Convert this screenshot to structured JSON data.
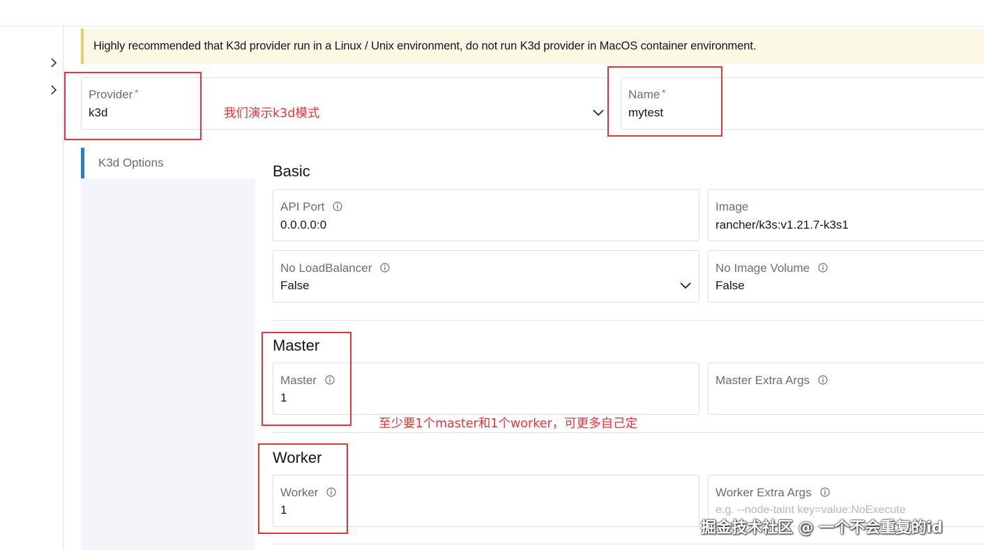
{
  "banner": {
    "text": "Highly recommended that K3d provider run in a Linux / Unix environment, do not run K3d provider in MacOS container environment."
  },
  "provider": {
    "label": "Provider",
    "required_mark": "*",
    "value": "k3d"
  },
  "name": {
    "label": "Name",
    "required_mark": "*",
    "value": "mytest"
  },
  "tabs": [
    {
      "label": "K3d Options"
    }
  ],
  "basic": {
    "title": "Basic",
    "api_port": {
      "label": "API Port",
      "value": "0.0.0.0:0"
    },
    "image": {
      "label": "Image",
      "value": "rancher/k3s:v1.21.7-k3s1"
    },
    "no_loadbalancer": {
      "label": "No LoadBalancer",
      "value": "False"
    },
    "no_image_volume": {
      "label": "No Image Volume",
      "value": "False"
    }
  },
  "master": {
    "title": "Master",
    "count": {
      "label": "Master",
      "value": "1"
    },
    "extra_args": {
      "label": "Master Extra Args",
      "value": ""
    }
  },
  "worker": {
    "title": "Worker",
    "count": {
      "label": "Worker",
      "value": "1"
    },
    "extra_args": {
      "label": "Worker Extra Args",
      "placeholder": "e.g. --node-taint key=value:NoExecute"
    }
  },
  "annotations": {
    "provider_note": "我们演示k3d模式",
    "count_note": "至少要1个master和1个worker，可更多自己定"
  },
  "watermark": "掘金技术社区 @ 一个不会重复的id",
  "colors": {
    "accent_tab": "#2d7fc4",
    "banner_bg": "#fbf8e6",
    "banner_border": "#e6cf6a",
    "annotation_red": "#e8323a",
    "required_red": "#e0313b"
  }
}
